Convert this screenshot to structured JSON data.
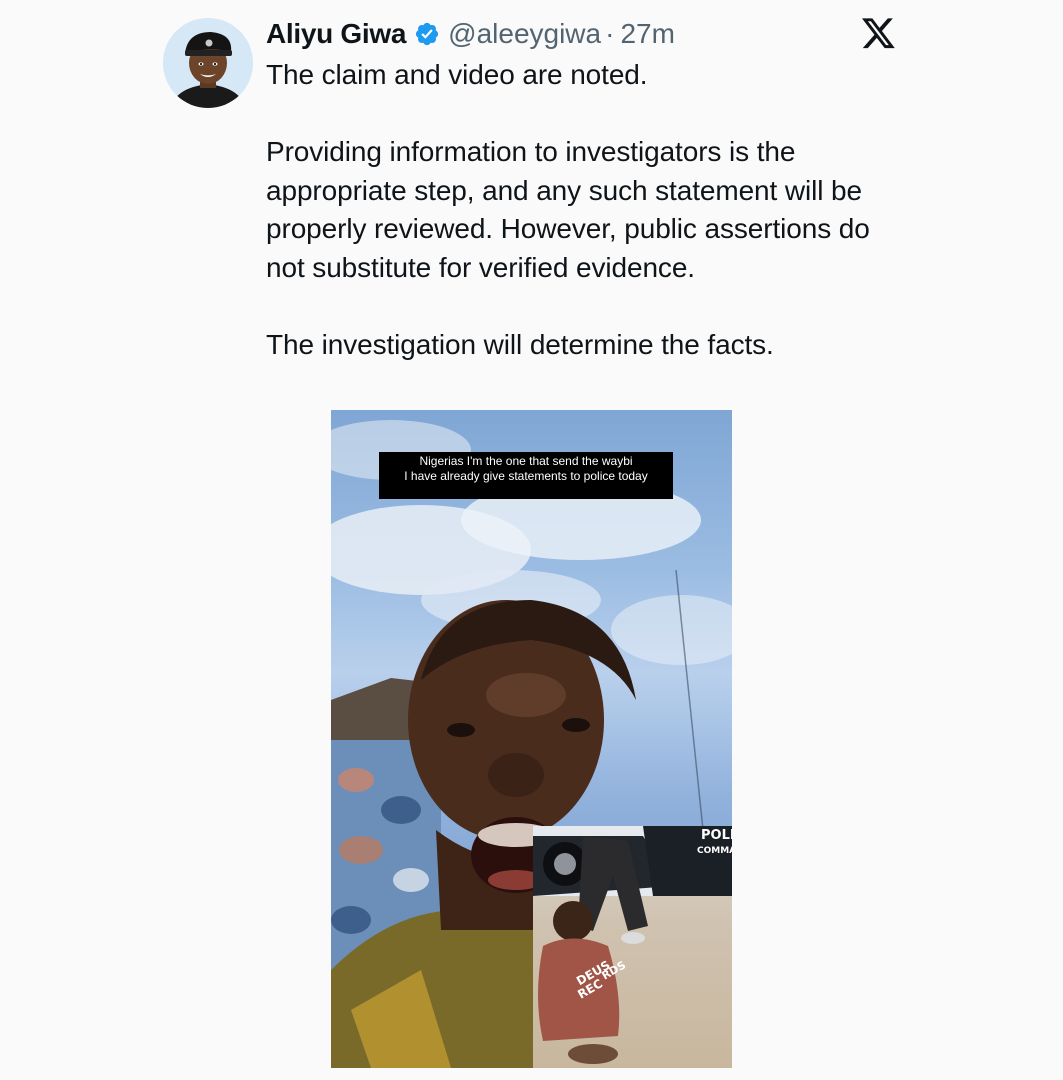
{
  "tweet": {
    "author": {
      "display_name": "Aliyu Giwa",
      "handle": "@aleeygiwa",
      "verified": true,
      "verified_icon": "verified-badge-icon",
      "avatar": "police-officer-avatar"
    },
    "separator": "·",
    "timestamp": "27m",
    "platform_icon": "x-logo-icon",
    "paragraphs": [
      "The claim and video are noted.",
      "Providing information to investigators is the appropriate step, and any such statement will be properly reviewed. However, public assertions do not substitute for verified evidence.",
      "The investigation will determine the facts."
    ],
    "media": {
      "caption_line1": "Nigerias  I'm the one that send the waybi",
      "caption_line2": "I have already give statements to  police today",
      "inset_shirt_text_1": "DEUS",
      "inset_shirt_text_2": "REC",
      "inset_shirt_text_3": "RDS",
      "inset_car_text_1": "POLI",
      "inset_car_text_2": "COMMA"
    }
  },
  "colors": {
    "background": "#fafafa",
    "text_primary": "#0f1419",
    "text_secondary": "#536471",
    "verified_blue": "#1d9bf0"
  }
}
